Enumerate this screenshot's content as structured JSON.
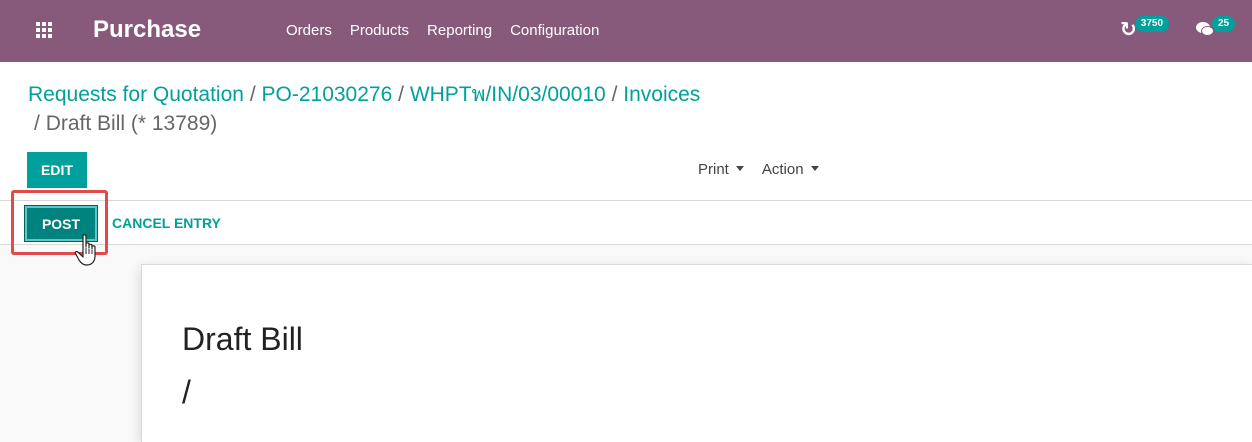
{
  "navbar": {
    "app_title": "Purchase",
    "menu": [
      "Orders",
      "Products",
      "Reporting",
      "Configuration"
    ],
    "activity_count": "3750",
    "messages_count": "25",
    "color": "#875a7b"
  },
  "breadcrumb": {
    "items": [
      "Requests for Quotation",
      "PO-21030276",
      "WHPTพ/IN/03/00010",
      "Invoices"
    ],
    "separator": "/",
    "current": "Draft Bill (* 13789)"
  },
  "controls": {
    "edit_label": "EDIT",
    "print_label": "Print",
    "action_label": "Action"
  },
  "statusbar": {
    "post_label": "POST",
    "cancel_label": "CANCEL ENTRY"
  },
  "sheet": {
    "title": "Draft Bill",
    "subtitle": "/"
  },
  "colors": {
    "accent": "#00a09d",
    "post_button": "#00827f",
    "highlight": "#e04a4a"
  }
}
